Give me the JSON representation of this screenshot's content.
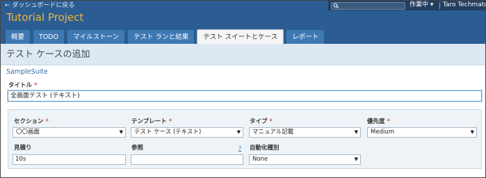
{
  "header": {
    "back_link": "← ダッシュボードに戻る",
    "project_title": "Tutorial Project",
    "search_icon": "search-icon",
    "status_menu": "作業中 ▾",
    "user_name": "Taro Techmatrix"
  },
  "tabs": [
    {
      "label": "概要"
    },
    {
      "label": "TODO"
    },
    {
      "label": "マイルストーン"
    },
    {
      "label": "テスト ランと結果"
    },
    {
      "label": "テスト スイートとケース",
      "active": true
    },
    {
      "label": "レポート"
    }
  ],
  "page": {
    "title": "テスト ケースの追加",
    "suite_link": "SampleSuite",
    "title_label": "タイトル",
    "title_value": "全画面テスト (テキスト)"
  },
  "form": {
    "section": {
      "label": "セクション",
      "value": "〇〇画面"
    },
    "template": {
      "label": "テンプレート",
      "value": "テスト ケース (テキスト)"
    },
    "type": {
      "label": "タイプ",
      "value": "マニュアル記載"
    },
    "priority": {
      "label": "優先度",
      "value": "Medium"
    },
    "estimate": {
      "label": "見積り",
      "value": "10s"
    },
    "references": {
      "label": "参照",
      "value": "",
      "help": "?"
    },
    "automation": {
      "label": "自動化種別",
      "value": "None"
    },
    "required_mark": "*"
  },
  "colors": {
    "header_bg": "#2b5d92",
    "project_title": "#f0b53a",
    "tab_bg": "#3e78b3",
    "tab_active_bg": "#f5f5f5",
    "page_header_bg": "#dde8f2",
    "panel_bg": "#eef3f8",
    "required": "#d9534f"
  }
}
